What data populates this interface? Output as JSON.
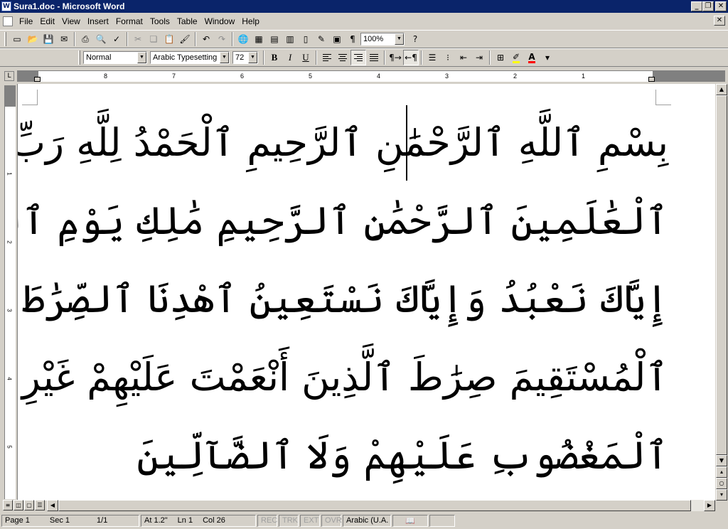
{
  "window": {
    "title": "Sura1.doc - Microsoft Word",
    "app_icon": "word-doc-icon"
  },
  "menu": {
    "items": [
      "File",
      "Edit",
      "View",
      "Insert",
      "Format",
      "Tools",
      "Table",
      "Window",
      "Help"
    ]
  },
  "standard_toolbar": {
    "zoom": "100%",
    "help_label": "?"
  },
  "formatting_toolbar": {
    "style": "Normal",
    "font": "Arabic Typesetting",
    "size": "72",
    "bold_label": "B",
    "italic_label": "I",
    "underline_label": "U",
    "font_color_label": "A",
    "highlight_color": "#ffff00",
    "font_color": "#ff0000"
  },
  "ruler": {
    "labels": [
      "8",
      "7",
      "6",
      "5",
      "4",
      "3",
      "2",
      "1"
    ]
  },
  "vertical_ruler": {
    "labels": [
      "1",
      "2",
      "3",
      "4",
      "5"
    ]
  },
  "document": {
    "text_color": "#000000",
    "diacritic_color": "#e07820",
    "lines": [
      "بِسْمِ ٱللَّهِ ٱلرَّحْمَٰنِ ٱلرَّحِيمِ ٱلْحَمْدُ لِلَّهِ رَبِّ",
      "ٱلْعَٰلَمِينَ ٱلرَّحْمَٰنِ ٱلرَّحِيمِ مَٰلِكِ يَوْمِ ٱلدِّينِ",
      "إِيَّاكَ نَعْبُدُ وَإِيَّاكَ نَسْتَعِينُ ٱهْدِنَا ٱلصِّرَٰطَ",
      "ٱلْمُسْتَقِيمَ صِرَٰطَ ٱلَّذِينَ أَنْعَمْتَ عَلَيْهِمْ غَيْرِ",
      "ٱلْمَغْضُوبِ عَلَيْهِمْ وَلَا ٱلضَّآلِّينَ"
    ]
  },
  "status_bar": {
    "page": "Page 1",
    "sec": "Sec 1",
    "pages": "1/1",
    "at": "At 1.2\"",
    "ln": "Ln 1",
    "col": "Col 26",
    "rec": "REC",
    "trk": "TRK",
    "ext": "EXT",
    "ovr": "OVR",
    "language": "Arabic (U.A.",
    "spelling_icon": "book-check-icon"
  }
}
